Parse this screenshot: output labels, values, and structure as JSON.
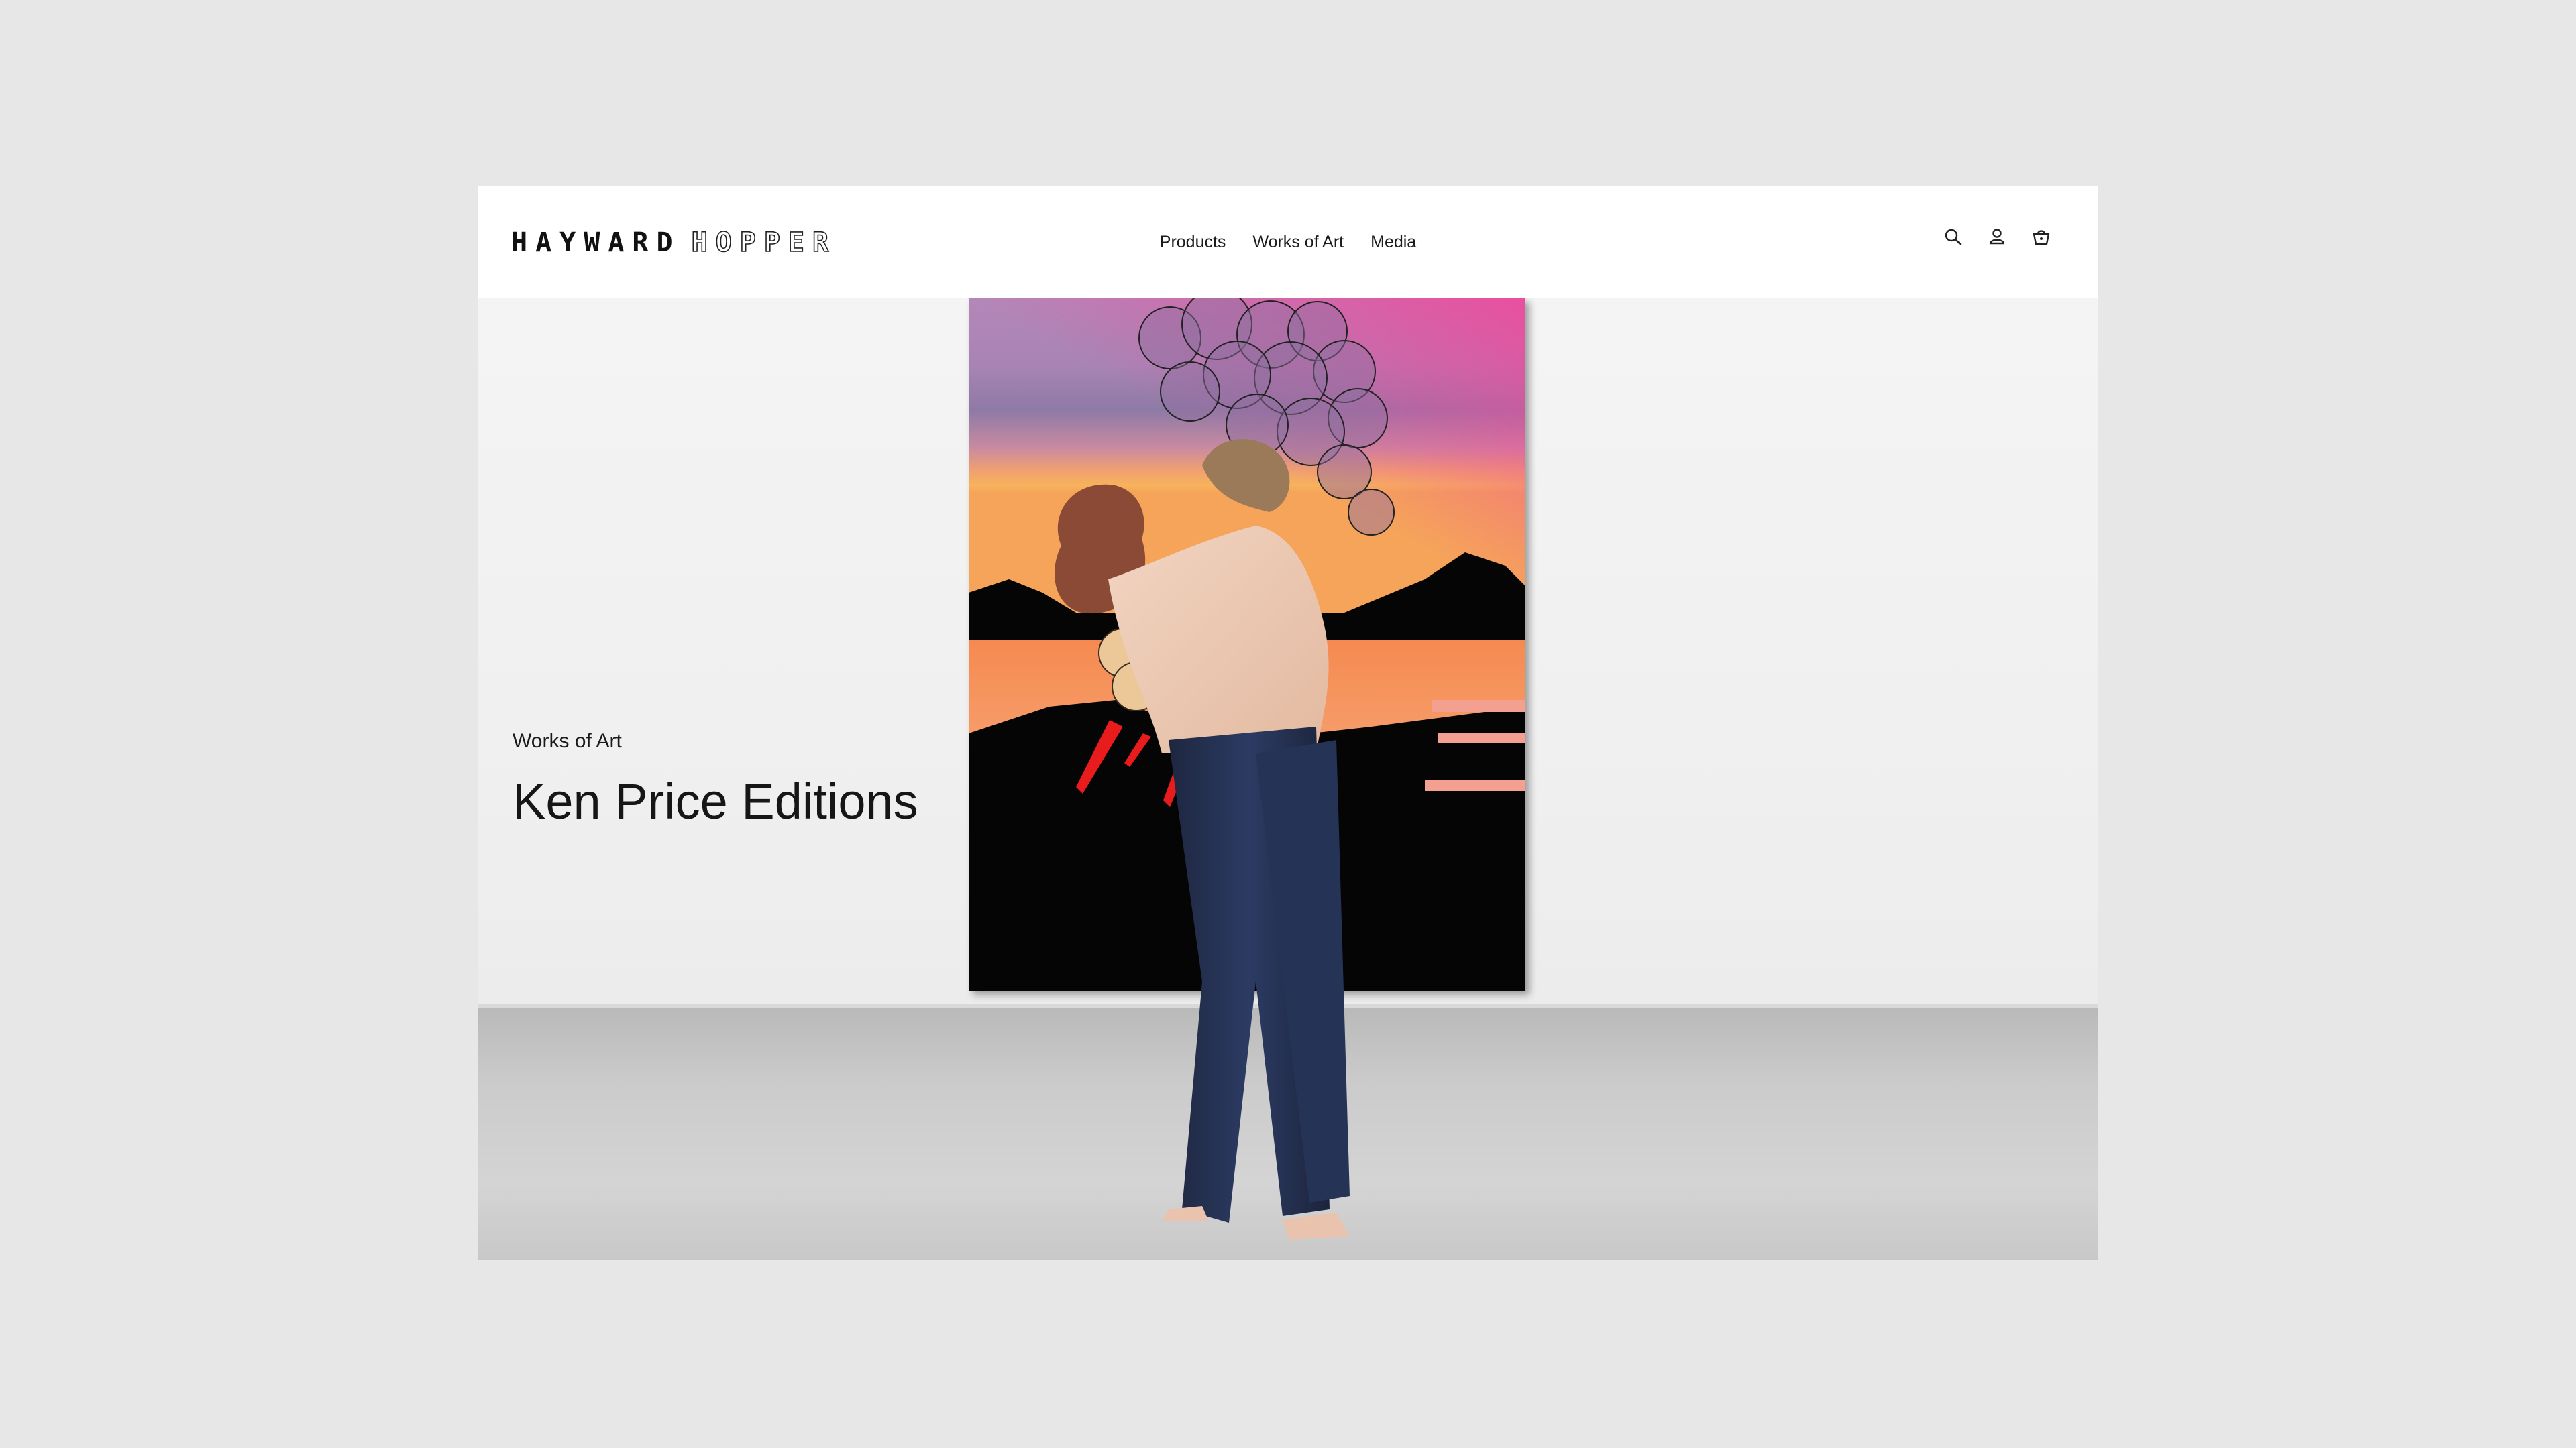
{
  "header": {
    "logo_part_1": "HAYWARD",
    "logo_part_2": "HOPPER",
    "nav": [
      "Products",
      "Works of Art",
      "Media"
    ],
    "icons": [
      "search-icon",
      "account-icon",
      "basket-icon"
    ]
  },
  "hero": {
    "eyebrow": "Works of Art",
    "title": "Ken Price Editions"
  },
  "colors": {
    "page_background": "#e7e7e7",
    "header_background": "#ffffff",
    "text": "#161616"
  }
}
